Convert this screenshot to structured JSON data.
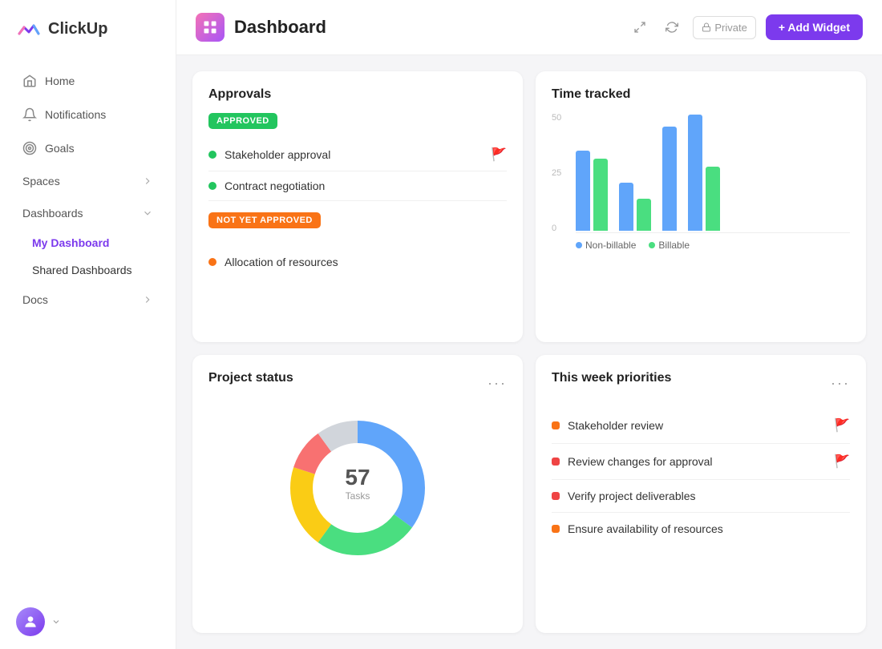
{
  "app": {
    "name": "ClickUp"
  },
  "sidebar": {
    "nav_items": [
      {
        "id": "home",
        "label": "Home",
        "icon": "home"
      },
      {
        "id": "notifications",
        "label": "Notifications",
        "icon": "bell"
      },
      {
        "id": "goals",
        "label": "Goals",
        "icon": "target"
      }
    ],
    "sections": [
      {
        "id": "spaces",
        "label": "Spaces",
        "has_arrow": true,
        "items": []
      },
      {
        "id": "dashboards",
        "label": "Dashboards",
        "has_arrow": true,
        "items": [
          {
            "id": "my-dashboard",
            "label": "My Dashboard",
            "active": true
          },
          {
            "id": "shared-dashboards",
            "label": "Shared Dashboards",
            "active": false
          }
        ]
      },
      {
        "id": "docs",
        "label": "Docs",
        "has_arrow": true,
        "items": []
      }
    ]
  },
  "header": {
    "title": "Dashboard",
    "private_label": "Private",
    "add_widget_label": "+ Add Widget"
  },
  "approvals_widget": {
    "title": "Approvals",
    "approved_label": "APPROVED",
    "not_yet_approved_label": "NOT YET APPROVED",
    "approved_items": [
      {
        "name": "Stakeholder approval",
        "has_flag": true
      },
      {
        "name": "Contract negotiation",
        "has_flag": false
      }
    ],
    "not_approved_items": [
      {
        "name": "Allocation of resources",
        "has_flag": false
      }
    ]
  },
  "time_tracked_widget": {
    "title": "Time tracked",
    "y_labels": [
      "50",
      "25",
      "0"
    ],
    "legend": [
      {
        "label": "Non-billable",
        "color": "#60a5fa"
      },
      {
        "label": "Billable",
        "color": "#4ade80"
      }
    ],
    "bar_groups": [
      {
        "blue_height": 100,
        "green_height": 90
      },
      {
        "blue_height": 60,
        "green_height": 40
      },
      {
        "blue_height": 120,
        "green_height": 0
      },
      {
        "blue_height": 140,
        "green_height": 80
      }
    ]
  },
  "project_status_widget": {
    "title": "Project status",
    "donut_center_value": "57",
    "donut_center_label": "Tasks",
    "segments": [
      {
        "color": "#60a5fa",
        "percent": 35
      },
      {
        "color": "#4ade80",
        "percent": 25
      },
      {
        "color": "#facc15",
        "percent": 20
      },
      {
        "color": "#f87171",
        "percent": 10
      },
      {
        "color": "#d1d5db",
        "percent": 10
      }
    ]
  },
  "priorities_widget": {
    "title": "This week priorities",
    "items": [
      {
        "name": "Stakeholder review",
        "color": "#f97316",
        "has_flag": true
      },
      {
        "name": "Review changes for approval",
        "color": "#ef4444",
        "has_flag": true
      },
      {
        "name": "Verify project deliverables",
        "color": "#ef4444",
        "has_flag": false
      },
      {
        "name": "Ensure availability of resources",
        "color": "#f97316",
        "has_flag": false
      }
    ]
  }
}
